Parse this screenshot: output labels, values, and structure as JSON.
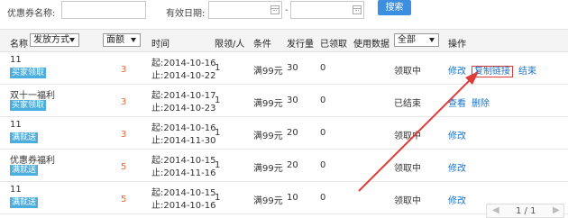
{
  "filters": {
    "coupon_name_label": "优惠券名称:",
    "coupon_name_value": "",
    "validity_label": "有效日期:",
    "date_start_value": "",
    "date_separator": "-",
    "date_end_value": "",
    "search_label": "搜索"
  },
  "table": {
    "headers": {
      "name": "名称",
      "issue_method_select": "发放方式",
      "amount_select": "面额",
      "time": "时间",
      "limit": "限领/人",
      "condition": "条件",
      "issued": "发行量",
      "received": "已领取",
      "usage": "使用数据",
      "status_select": "全部",
      "ops": "操作"
    },
    "rows": [
      {
        "name": "11",
        "tag": "买家领取",
        "amount": "3",
        "start": "起:2014-10-16",
        "end": "止:2014-10-22",
        "limit": "1",
        "condition": "满99元",
        "issued": "30",
        "received": "0",
        "status": "领取中",
        "ops": [
          "修改",
          "复制链接",
          "结束"
        ]
      },
      {
        "name": "双十一福利",
        "tag": "买家领取",
        "amount": "3",
        "start": "起:2014-10-17",
        "end": "止:2014-10-23",
        "limit": "1",
        "condition": "满99元",
        "issued": "30",
        "received": "0",
        "status": "已结束",
        "ops": [
          "查看",
          "删除"
        ]
      },
      {
        "name": "11",
        "tag": "满就送",
        "amount": "3",
        "start": "起:2014-10-16",
        "end": "止:2014-11-30",
        "limit": "1",
        "condition": "满99元",
        "issued": "20",
        "received": "0",
        "status": "领取中",
        "ops": [
          "修改"
        ]
      },
      {
        "name": "优惠券福利",
        "tag": "满就送",
        "amount": "5",
        "start": "起:2014-10-15",
        "end": "止:2014-11-16",
        "limit": "1",
        "condition": "满99元",
        "issued": "20",
        "received": "0",
        "status": "领取中",
        "ops": [
          "修改"
        ]
      },
      {
        "name": "11",
        "tag": "满就送",
        "amount": "5",
        "start": "起:2014-10-15",
        "end": "止:2014-10-16",
        "limit": "1",
        "condition": "满99元",
        "issued": "10",
        "received": "0",
        "status": "领取中",
        "ops": [
          "修改"
        ]
      }
    ]
  },
  "pagination": {
    "prev": "◀",
    "page_text": "1 / 1",
    "next": "▶"
  },
  "annotation": {
    "arrow_color": "#e03b3b"
  },
  "colors": {
    "accent": "#3b8ee0",
    "tag": "#4aaede",
    "amount": "#e8662d",
    "link": "#1a73c9"
  }
}
